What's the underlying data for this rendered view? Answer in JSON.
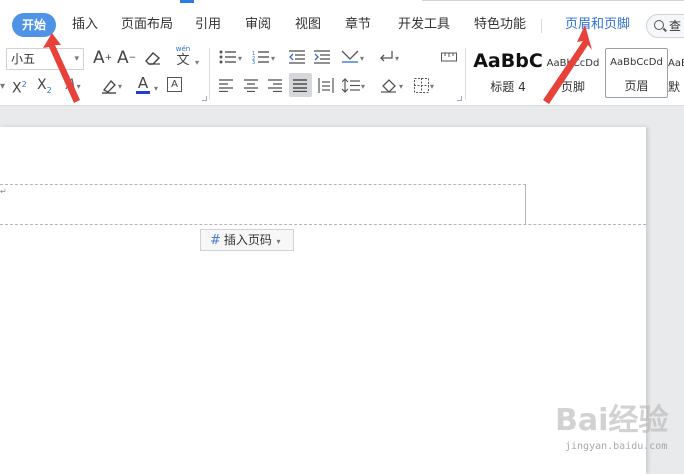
{
  "menu": {
    "items": [
      {
        "label": "开始"
      },
      {
        "label": "插入"
      },
      {
        "label": "页面布局"
      },
      {
        "label": "引用"
      },
      {
        "label": "审阅"
      },
      {
        "label": "视图"
      },
      {
        "label": "章节"
      },
      {
        "label": "开发工具"
      },
      {
        "label": "特色功能"
      },
      {
        "label": "页眉和页脚"
      }
    ],
    "search_label": "查"
  },
  "toolbar": {
    "font_size_value": "小五",
    "increase_font": "A",
    "decrease_font": "A",
    "phonetic_label": "wén",
    "phonetic_char": "文",
    "superscript_base": "X",
    "superscript_exp": "2",
    "subscript_base": "X",
    "subscript_exp": "2",
    "font_color_label": "A",
    "font_color": "#1f3fd6",
    "char_border_label": "A",
    "text_effect_label": "A"
  },
  "styles": [
    {
      "sample": "AaBbC",
      "label": "标题 4"
    },
    {
      "sample": "AaBbCcDd",
      "label": "页脚"
    },
    {
      "sample": "AaBbCcDd",
      "label": "页眉"
    },
    {
      "sample": "AaB",
      "label": "默"
    }
  ],
  "document": {
    "paragraph_mark": "↵",
    "insert_page_number_label": "插入页码"
  },
  "watermark": {
    "brand": "Bai经验",
    "url": "jingyan.baidu.com"
  },
  "colors": {
    "accent": "#4f93e6",
    "arrow": "#e8413a",
    "highlight_tab": "#2b6fd6"
  }
}
